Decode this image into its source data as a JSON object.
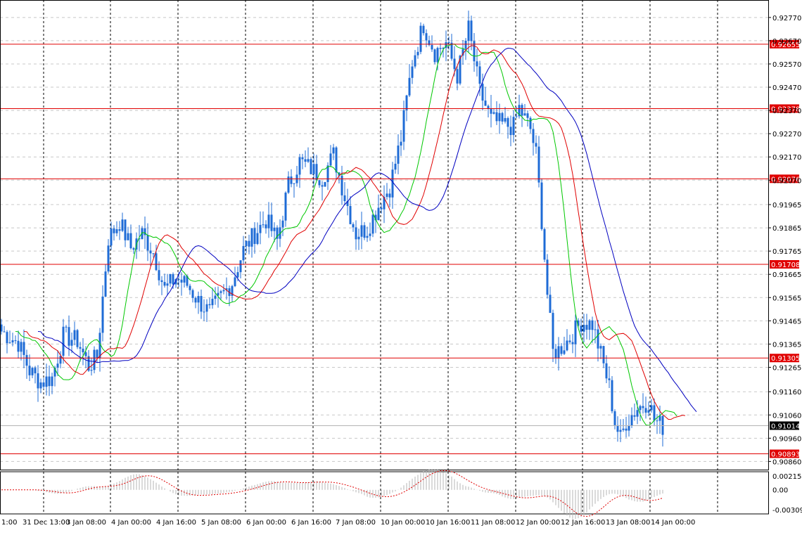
{
  "colors": {
    "background": "#ffffff",
    "grid": "#c8c8c8",
    "vgrid": "#000000",
    "candle": "#1e6bd6",
    "frame": "#000000",
    "level": "#e00000",
    "label_text": "#ffffff",
    "ma_fast": "#00c800",
    "ma_mid": "#e00000",
    "ma_slow": "#0000c0",
    "histogram": "#b4b4b4",
    "signal": "#e00000",
    "bid_line": "#b4b4b4"
  },
  "chart_data": [
    {
      "type": "candlestick",
      "name": "price",
      "ylim": [
        0.0086,
        0.0093
      ],
      "y_min": 0.9086,
      "y_max": 0.9281,
      "yticks": [
        "0.92770",
        "0.92670",
        "0.92570",
        "0.92470",
        "0.92370",
        "0.92270",
        "0.92170",
        "0.92070",
        "0.91965",
        "0.91865",
        "0.91765",
        "0.91665",
        "0.91565",
        "0.91465",
        "0.91365",
        "0.91265",
        "0.91160",
        "0.91060",
        "0.90960",
        "0.90860"
      ],
      "ytick_values": [
        0.9277,
        0.9267,
        0.9257,
        0.9247,
        0.9237,
        0.9227,
        0.9217,
        0.9207,
        0.91965,
        0.91865,
        0.91765,
        0.91665,
        0.91565,
        0.91465,
        0.91365,
        0.91265,
        0.9116,
        0.9106,
        0.9096,
        0.9086
      ],
      "levels": [
        {
          "value": 0.92655,
          "label": "0.92655"
        },
        {
          "value": 0.92378,
          "label": "0.92378"
        },
        {
          "value": 0.92076,
          "label": "0.92076"
        },
        {
          "value": 0.91708,
          "label": "0.91708"
        },
        {
          "value": 0.91305,
          "label": "0.91305"
        },
        {
          "value": 0.90893,
          "label": "0.90893"
        }
      ],
      "current_price": {
        "value": 0.91014,
        "label": "0.91014"
      },
      "xticks": [
        "1:00",
        "31 Dec 13:00",
        "3 Jan 08:00",
        "4 Jan 00:00",
        "4 Jan 16:00",
        "5 Jan 08:00",
        "6 Jan 00:00",
        "6 Jan 16:00",
        "7 Jan 08:00",
        "10 Jan 00:00",
        "10 Jan 16:00",
        "11 Jan 08:00",
        "12 Jan 00:00",
        "12 Jan 16:00",
        "13 Jan 08:00",
        "14 Jan 00:00"
      ],
      "close_anchors": [
        [
          0,
          0.9142
        ],
        [
          6,
          0.9137
        ],
        [
          10,
          0.9125
        ],
        [
          14,
          0.912
        ],
        [
          18,
          0.9122
        ],
        [
          22,
          0.914
        ],
        [
          27,
          0.9138
        ],
        [
          31,
          0.9127
        ],
        [
          34,
          0.9131
        ],
        [
          38,
          0.9182
        ],
        [
          42,
          0.9189
        ],
        [
          46,
          0.9178
        ],
        [
          50,
          0.9184
        ],
        [
          54,
          0.9176
        ],
        [
          58,
          0.916
        ],
        [
          62,
          0.9165
        ],
        [
          66,
          0.9162
        ],
        [
          70,
          0.9155
        ],
        [
          74,
          0.915
        ],
        [
          78,
          0.9157
        ],
        [
          82,
          0.9163
        ],
        [
          86,
          0.9177
        ],
        [
          90,
          0.9184
        ],
        [
          94,
          0.919
        ],
        [
          98,
          0.9181
        ],
        [
          102,
          0.9205
        ],
        [
          106,
          0.9215
        ],
        [
          110,
          0.9212
        ],
        [
          114,
          0.9208
        ],
        [
          118,
          0.9218
        ],
        [
          122,
          0.92
        ],
        [
          126,
          0.9184
        ],
        [
          130,
          0.9186
        ],
        [
          134,
          0.9196
        ],
        [
          138,
          0.9204
        ],
        [
          142,
          0.9225
        ],
        [
          146,
          0.9258
        ],
        [
          150,
          0.9274
        ],
        [
          154,
          0.9262
        ],
        [
          158,
          0.9266
        ],
        [
          162,
          0.9252
        ],
        [
          166,
          0.9272
        ],
        [
          170,
          0.9245
        ],
        [
          174,
          0.9233
        ],
        [
          178,
          0.9231
        ],
        [
          182,
          0.923
        ],
        [
          184,
          0.9238
        ],
        [
          188,
          0.9229
        ],
        [
          190,
          0.9218
        ],
        [
          192,
          0.919
        ],
        [
          194,
          0.9158
        ],
        [
          196,
          0.9133
        ],
        [
          198,
          0.9134
        ],
        [
          202,
          0.9139
        ],
        [
          206,
          0.9146
        ],
        [
          210,
          0.9145
        ],
        [
          213,
          0.9132
        ],
        [
          216,
          0.9118
        ],
        [
          218,
          0.9103
        ],
        [
          220,
          0.9096
        ],
        [
          222,
          0.9103
        ],
        [
          226,
          0.9109
        ],
        [
          230,
          0.9112
        ],
        [
          232,
          0.9104
        ],
        [
          235,
          0.9101
        ]
      ]
    },
    {
      "type": "histogram",
      "name": "oscillator",
      "ylim": [
        -0.003096,
        0.002154
      ],
      "yticks": [
        "0.002154",
        "0.00",
        "-0.003096"
      ],
      "ytick_values": [
        0.002154,
        0,
        -0.003096
      ]
    }
  ]
}
